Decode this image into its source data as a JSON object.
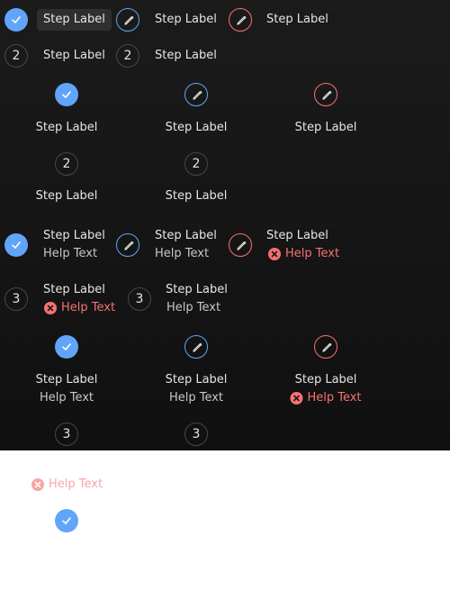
{
  "steps": {
    "label": "Step Label",
    "help": "Help Text",
    "num2": "2",
    "num3": "3"
  },
  "colors": {
    "complete": "#60a5fa",
    "edit_info": "#60a5fa",
    "edit_error": "#f87171",
    "number_border": "#474747"
  },
  "icons": {
    "complete": "check-icon",
    "edit": "pencil-icon",
    "error": "error-x-icon"
  }
}
